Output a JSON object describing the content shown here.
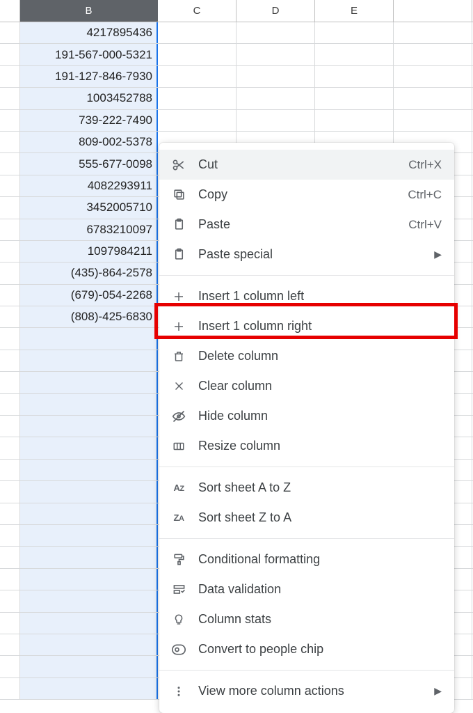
{
  "columns": [
    "B",
    "C",
    "D",
    "E",
    ""
  ],
  "selected_column_index": 0,
  "cells_B": [
    "4217895436",
    "191-567-000-5321",
    "191-127-846-7930",
    "1003452788",
    "739-222-7490",
    "809-002-5378",
    "555-677-0098",
    "4082293911",
    "3452005710",
    "6783210097",
    "1097984211",
    "(435)-864-2578",
    "(679)-054-2268",
    "(808)-425-6830"
  ],
  "row_count_visible": 31,
  "menu": {
    "cut": {
      "label": "Cut",
      "shortcut": "Ctrl+X"
    },
    "copy": {
      "label": "Copy",
      "shortcut": "Ctrl+C"
    },
    "paste": {
      "label": "Paste",
      "shortcut": "Ctrl+V"
    },
    "paste_special": {
      "label": "Paste special"
    },
    "insert_left": {
      "label": "Insert 1 column left"
    },
    "insert_right": {
      "label": "Insert 1 column right"
    },
    "delete_col": {
      "label": "Delete column"
    },
    "clear_col": {
      "label": "Clear column"
    },
    "hide_col": {
      "label": "Hide column"
    },
    "resize_col": {
      "label": "Resize column"
    },
    "sort_az": {
      "label": "Sort sheet A to Z"
    },
    "sort_za": {
      "label": "Sort sheet Z to A"
    },
    "cond_fmt": {
      "label": "Conditional formatting"
    },
    "data_val": {
      "label": "Data validation"
    },
    "col_stats": {
      "label": "Column stats"
    },
    "people_chip": {
      "label": "Convert to people chip"
    },
    "view_more": {
      "label": "View more column actions"
    }
  },
  "highlighted_menu_item": "insert_right"
}
